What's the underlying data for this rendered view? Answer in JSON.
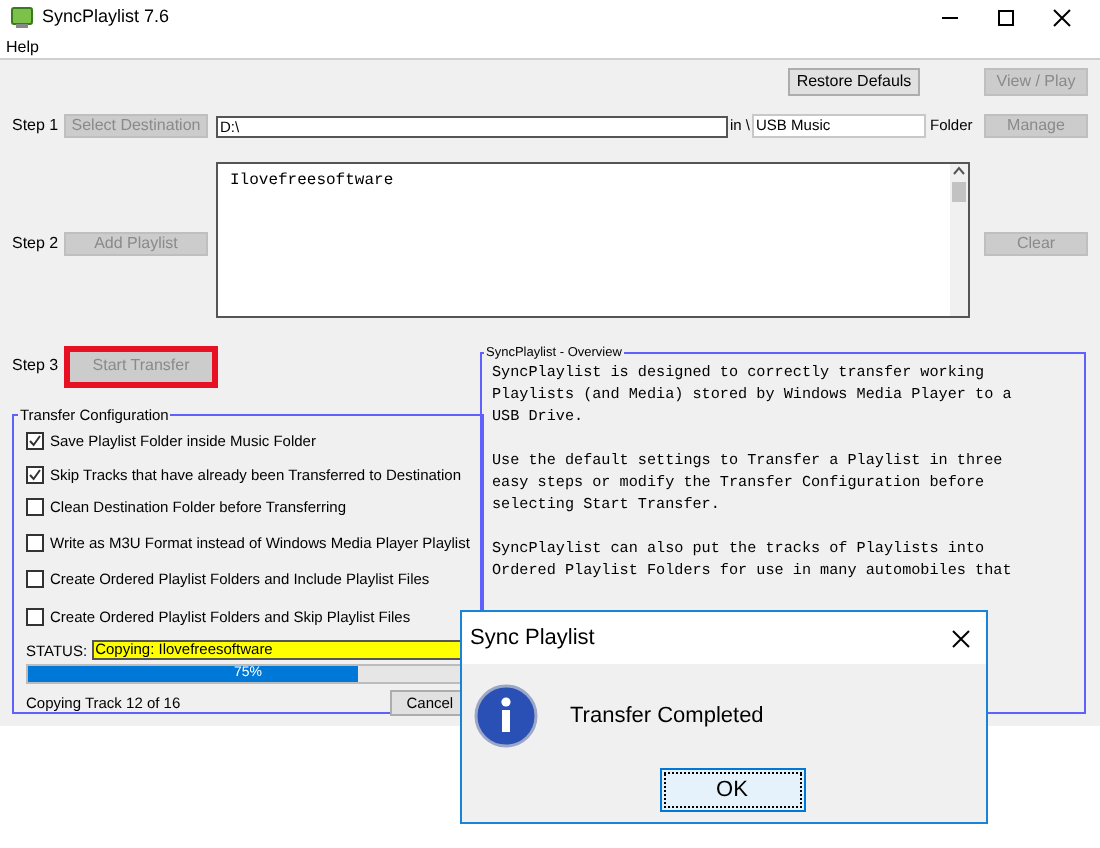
{
  "window": {
    "title": "SyncPlaylist 7.6"
  },
  "menu": [
    "Help"
  ],
  "top_buttons": [
    {
      "label": "Restore Defauls",
      "disabled": false
    },
    {
      "label": "View / Play",
      "disabled": true
    }
  ],
  "step1": {
    "label": "Step 1",
    "button": {
      "label": "Select Destination",
      "disabled": true
    },
    "destination": "D:\\",
    "in_label": "in \\",
    "folder": "USB Music",
    "folder_label": "Folder",
    "side_button": {
      "label": "Manage",
      "disabled": true
    }
  },
  "step2": {
    "label": "Step 2",
    "button": {
      "label": "Add Playlist",
      "disabled": true
    },
    "playlists": [
      "Ilovefreesoftware"
    ],
    "side_button": {
      "label": "Clear",
      "disabled": true
    }
  },
  "step3": {
    "label": "Step 3",
    "button": {
      "label": "Start Transfer",
      "disabled": true,
      "highlighted": true
    }
  },
  "transfer_configuration": {
    "title": "Transfer Configuration",
    "options": [
      {
        "label": "Save Playlist Folder inside Music Folder",
        "checked": true
      },
      {
        "label": "Skip Tracks that have already been Transferred to Destination",
        "checked": true
      },
      {
        "label": "Clean Destination Folder before Transferring",
        "checked": false
      },
      {
        "label": "Write as M3U Format instead of Windows Media Player Playlist",
        "checked": false
      },
      {
        "label": "Create Ordered Playlist Folders and Include Playlist Files",
        "checked": false
      },
      {
        "label": "Create Ordered Playlist Folders and Skip Playlist Files",
        "checked": false
      }
    ],
    "status_label": "STATUS:",
    "status": "Copying: Ilovefreesoftware",
    "progress": {
      "level": 0.75,
      "reading": "75%"
    },
    "track_info": "Copying Track 12 of 16",
    "cancel": "Cancel"
  },
  "overview": {
    "title": "SyncPlaylist - Overview",
    "paragraphs": [
      [
        "SyncPlaylist is designed to correctly transfer working",
        "Playlists (and Media) stored by Windows Media Player to a",
        "USB Drive."
      ],
      [
        "Use the default settings to Transfer a Playlist in three",
        "easy steps or modify the Transfer Configuration before",
        "selecting Start Transfer."
      ],
      [
        "SyncPlaylist can also put the tracks of Playlists into",
        "Ordered Playlist Folders for use in many automobiles that"
      ]
    ]
  },
  "dialog": {
    "title": "Sync Playlist",
    "message": "Transfer Completed",
    "button": "OK"
  }
}
